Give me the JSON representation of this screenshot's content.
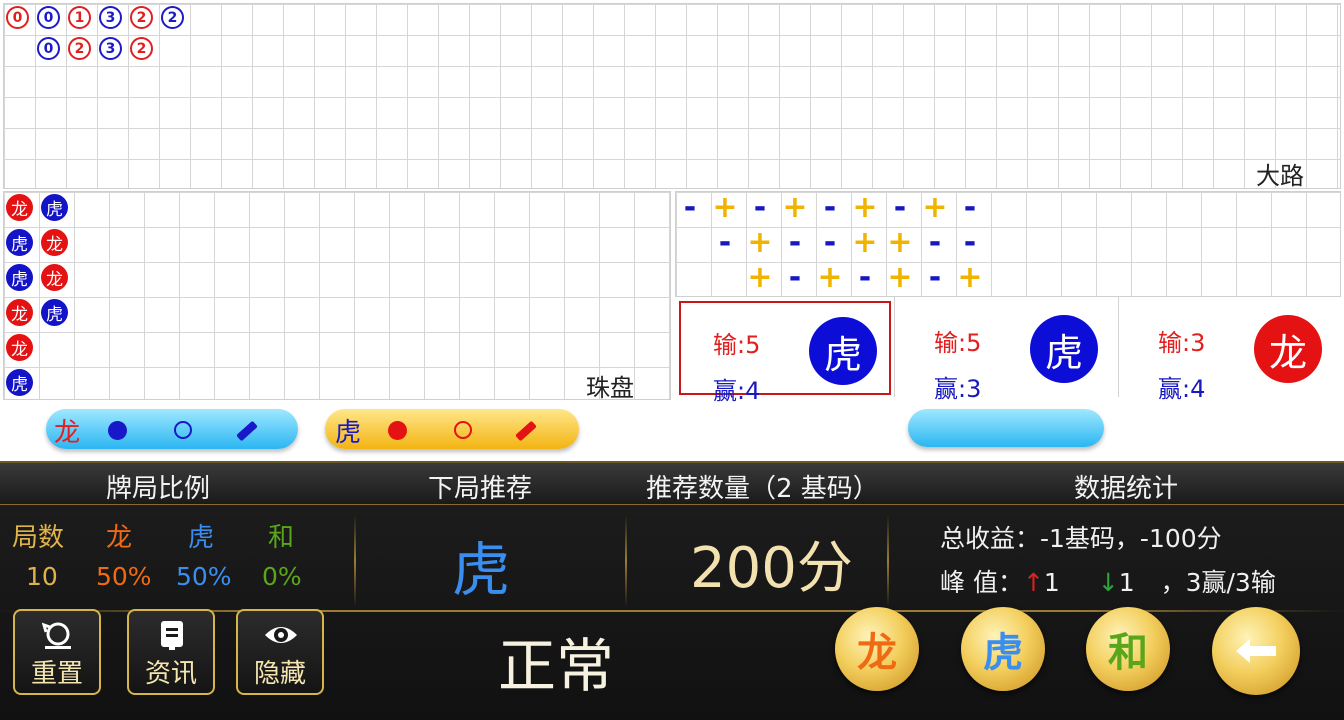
{
  "big_road": {
    "label": "大路",
    "rows": [
      [
        {
          "n": "0",
          "c": "red"
        },
        {
          "n": "0",
          "c": "blue"
        },
        {
          "n": "1",
          "c": "red"
        },
        {
          "n": "3",
          "c": "blue"
        },
        {
          "n": "2",
          "c": "red"
        },
        {
          "n": "2",
          "c": "blue"
        }
      ],
      [
        {
          "n": "0",
          "c": "blue"
        },
        {
          "n": "2",
          "c": "red"
        },
        {
          "n": "3",
          "c": "blue"
        },
        {
          "n": "2",
          "c": "red"
        }
      ]
    ]
  },
  "bead_plate": {
    "label": "珠盘",
    "col1": [
      "龙",
      "虎",
      "虎",
      "龙",
      "龙",
      "虎"
    ],
    "col2": [
      "虎",
      "龙",
      "龙",
      "虎"
    ]
  },
  "derived_road": {
    "rows": [
      [
        "-",
        "+",
        "-",
        "+",
        "-",
        "+",
        "-",
        "+",
        "-"
      ],
      [
        "-",
        "+",
        "-",
        "-",
        "+",
        "+",
        "-",
        "-"
      ],
      [
        "+",
        "-",
        "+",
        "-",
        "+",
        "-",
        "+"
      ]
    ]
  },
  "legend": {
    "dragon": "龙",
    "tiger": "虎"
  },
  "predictions": [
    {
      "lose": "输:5",
      "win": "赢:4",
      "pick": "虎",
      "color": "blue",
      "active": true
    },
    {
      "lose": "输:5",
      "win": "赢:3",
      "pick": "虎",
      "color": "blue",
      "active": false
    },
    {
      "lose": "输:3",
      "win": "赢:4",
      "pick": "龙",
      "color": "red",
      "active": false
    }
  ],
  "panel": {
    "headers": {
      "ratio": "牌局比例",
      "next": "下局推荐",
      "qty": "推荐数量（2 基码）",
      "stats": "数据统计"
    },
    "ratio": {
      "rounds_label": "局数",
      "rounds_value": "10",
      "dragon_label": "龙",
      "dragon_value": "50%",
      "tiger_label": "虎",
      "tiger_value": "50%",
      "tie_label": "和",
      "tie_value": "0%"
    },
    "next_pick": "虎",
    "qty_value": "200分",
    "stats": {
      "total": "总收益：-1基码，-100分",
      "peak_label": "峰  值：",
      "peak_up": "1",
      "peak_down": "1",
      "peak_record": "，3赢/3输"
    },
    "status": "正常",
    "buttons": {
      "reset": "重置",
      "news": "资讯",
      "hide": "隐藏",
      "dragon": "龙",
      "tiger": "虎",
      "tie": "和"
    },
    "colors": {
      "dragon": "#f06a14",
      "tiger": "#3a8ef0",
      "tie": "#5aa61a",
      "gold": "#e8c15a"
    }
  }
}
